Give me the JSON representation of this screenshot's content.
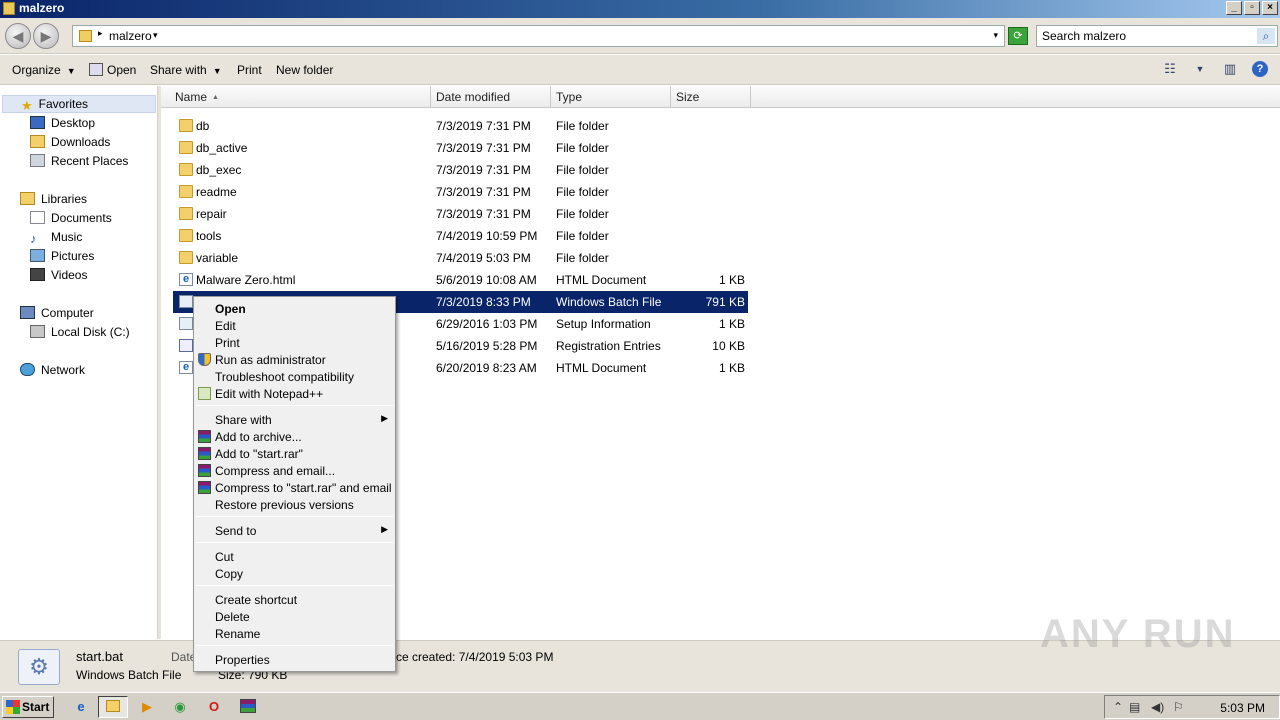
{
  "window": {
    "title": "malzero"
  },
  "address": {
    "path": "malzero",
    "search_placeholder": "Search malzero"
  },
  "toolbar": {
    "organize": "Organize",
    "open": "Open",
    "share_with": "Share with",
    "print": "Print",
    "new_folder": "New folder"
  },
  "nav": {
    "favorites": "Favorites",
    "desktop": "Desktop",
    "downloads": "Downloads",
    "recent_places": "Recent Places",
    "libraries": "Libraries",
    "documents": "Documents",
    "music": "Music",
    "pictures": "Pictures",
    "videos": "Videos",
    "computer": "Computer",
    "local_disk": "Local Disk (C:)",
    "network": "Network"
  },
  "columns": {
    "name": "Name",
    "date": "Date modified",
    "type": "Type",
    "size": "Size"
  },
  "files": [
    {
      "name": "db",
      "date": "7/3/2019 7:31 PM",
      "type": "File folder",
      "size": "",
      "icon": "folder-icon"
    },
    {
      "name": "db_active",
      "date": "7/3/2019 7:31 PM",
      "type": "File folder",
      "size": "",
      "icon": "folder-icon"
    },
    {
      "name": "db_exec",
      "date": "7/3/2019 7:31 PM",
      "type": "File folder",
      "size": "",
      "icon": "folder-icon"
    },
    {
      "name": "readme",
      "date": "7/3/2019 7:31 PM",
      "type": "File folder",
      "size": "",
      "icon": "folder-icon"
    },
    {
      "name": "repair",
      "date": "7/3/2019 7:31 PM",
      "type": "File folder",
      "size": "",
      "icon": "folder-icon"
    },
    {
      "name": "tools",
      "date": "7/4/2019 10:59 PM",
      "type": "File folder",
      "size": "",
      "icon": "folder-icon"
    },
    {
      "name": "variable",
      "date": "7/4/2019 5:03 PM",
      "type": "File folder",
      "size": "",
      "icon": "folder-icon"
    },
    {
      "name": "Malware Zero.html",
      "date": "5/6/2019 10:08 AM",
      "type": "HTML Document",
      "size": "1 KB",
      "icon": "html-icon"
    },
    {
      "name": "",
      "date": "7/3/2019 8:33 PM",
      "type": "Windows Batch File",
      "size": "791 KB",
      "icon": "batch-file-icon"
    },
    {
      "name": "",
      "date": "6/29/2016 1:03 PM",
      "type": "Setup Information",
      "size": "1 KB",
      "icon": "setup-info-icon"
    },
    {
      "name": "",
      "date": "5/16/2019 5:28 PM",
      "type": "Registration Entries",
      "size": "10 KB",
      "icon": "registry-icon"
    },
    {
      "name": "",
      "date": "6/20/2019 8:23 AM",
      "type": "HTML Document",
      "size": "1 KB",
      "icon": "html-icon"
    }
  ],
  "context_menu": {
    "open": "Open",
    "edit": "Edit",
    "print": "Print",
    "run_as_admin": "Run as administrator",
    "troubleshoot": "Troubleshoot compatibility",
    "edit_notepad": "Edit with Notepad++",
    "share_with": "Share with",
    "add_archive": "Add to archive...",
    "add_rar": "Add to \"start.rar\"",
    "compress_email": "Compress and email...",
    "compress_rar_email": "Compress to \"start.rar\" and email",
    "restore": "Restore previous versions",
    "send_to": "Send to",
    "cut": "Cut",
    "copy": "Copy",
    "create_shortcut": "Create shortcut",
    "delete": "Delete",
    "rename": "Rename",
    "properties": "Properties"
  },
  "details": {
    "filename": "start.bat",
    "filetype": "Windows Batch File",
    "date_label": "Date",
    "created": "ce created: 7/4/2019 5:03 PM",
    "size": "Size: 790 KB"
  },
  "watermark": "ANY RUN",
  "taskbar": {
    "start": "Start",
    "clock": "5:03 PM"
  }
}
